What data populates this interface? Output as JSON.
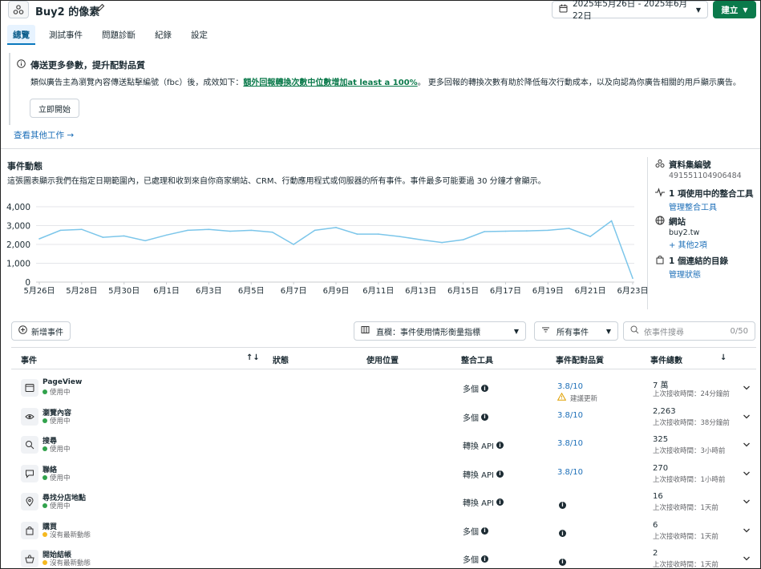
{
  "header": {
    "title": "Buy2 的像素",
    "date_range": "2025年5月26日 - 2025年6月22日",
    "create_label": "建立"
  },
  "tabs": [
    {
      "label": "總覽",
      "active": true
    },
    {
      "label": "測試事件"
    },
    {
      "label": "問題診斷"
    },
    {
      "label": "紀錄"
    },
    {
      "label": "設定"
    }
  ],
  "notice": {
    "title": "傳送更多參數，提升配對品質",
    "body_prefix": "類似廣告主為瀏覽內容傳送點擊編號（fbc）後，成效如下：",
    "body_link": "額外回報轉換次數中位數增加at least a 100%",
    "body_suffix": "。 更多回報的轉換次數有助於降低每次行動成本，以及向認為你廣告相關的用戶顯示廣告。",
    "start_label": "立即開始",
    "other_work": "查看其他工作 →"
  },
  "activity": {
    "title": "事件動態",
    "description": "這張圖表顯示我們在指定日期範圍內，已處理和收到來自你商家網站、CRM、行動應用程式或伺服器的所有事件。事件最多可能要過 30 分鐘才會顯示。"
  },
  "chart_data": {
    "type": "line",
    "x_tick_labels": [
      "5月26日",
      "5月28日",
      "5月30日",
      "6月1日",
      "6月3日",
      "6月5日",
      "6月7日",
      "6月9日",
      "6月11日",
      "6月13日",
      "6月15日",
      "6月17日",
      "6月19日",
      "6月21日",
      "6月23日"
    ],
    "y_tick_labels": [
      "0",
      "1,000",
      "2,000",
      "3,000",
      "4,000"
    ],
    "ylim": [
      0,
      4000
    ],
    "x": [
      "5月26日",
      "5月27日",
      "5月28日",
      "5月29日",
      "5月30日",
      "5月31日",
      "6月1日",
      "6月2日",
      "6月3日",
      "6月4日",
      "6月5日",
      "6月6日",
      "6月7日",
      "6月8日",
      "6月9日",
      "6月10日",
      "6月11日",
      "6月12日",
      "6月13日",
      "6月14日",
      "6月15日",
      "6月16日",
      "6月17日",
      "6月18日",
      "6月19日",
      "6月20日",
      "6月21日",
      "6月22日",
      "6月23日"
    ],
    "values": [
      2300,
      2750,
      2800,
      2380,
      2450,
      2200,
      2500,
      2750,
      2800,
      2700,
      2750,
      2650,
      2000,
      2750,
      2900,
      2550,
      2550,
      2420,
      2250,
      2100,
      2250,
      2680,
      2700,
      2720,
      2750,
      2850,
      2420,
      3250,
      200
    ],
    "color": "#7cc6ea",
    "grid": true
  },
  "sidebar": {
    "dataset_label": "資料集編號",
    "dataset_id": "491551104906484",
    "integrations_label": "1 項使用中的整合工具",
    "integrations_link": "管理整合工具",
    "website_label": "網站",
    "website_value": "buy2.tw",
    "website_link": "+ 其他2項",
    "catalog_label": "1 個連結的目錄",
    "catalog_link": "管理狀態"
  },
  "toolbar": {
    "add_event": "新增事件",
    "columns_select": "直欄：事件使用情形衡量指標",
    "events_select": "所有事件",
    "search_placeholder": "依事件搜尋",
    "search_count": "0/50"
  },
  "table": {
    "headers": {
      "event": "事件",
      "sort": "↑↓",
      "status": "狀態",
      "usage": "使用位置",
      "tool": "整合工具",
      "quality": "事件配對品質",
      "total": "事件總數",
      "total_sort": "↓"
    },
    "rows": [
      {
        "name": "PageView",
        "status": "使用中",
        "status_color": "#31a24c",
        "icon": "browser-icon",
        "tool": "多個",
        "quality": "3.8/10",
        "warning": "建議更新",
        "total": "7 萬",
        "last": "上次接收時間：24分鐘前"
      },
      {
        "name": "瀏覽內容",
        "status": "使用中",
        "status_color": "#31a24c",
        "icon": "eye-icon",
        "tool": "多個",
        "quality": "3.8/10",
        "total": "2,263",
        "last": "上次接收時間：38分鐘前"
      },
      {
        "name": "搜尋",
        "status": "使用中",
        "status_color": "#31a24c",
        "icon": "search-icon",
        "tool": "轉換 API",
        "quality": "3.8/10",
        "total": "325",
        "last": "上次接收時間：3小時前"
      },
      {
        "name": "聯絡",
        "status": "使用中",
        "status_color": "#31a24c",
        "icon": "chat-icon",
        "tool": "轉換 API",
        "quality": "3.8/10",
        "total": "270",
        "last": "上次接收時間：1小時前"
      },
      {
        "name": "尋找分店地點",
        "status": "使用中",
        "status_color": "#31a24c",
        "icon": "location-icon",
        "tool": "轉換 API",
        "quality": "",
        "total": "16",
        "last": "上次接收時間：1天前"
      },
      {
        "name": "購買",
        "status": "沒有最新動態",
        "status_color": "#f5b91f",
        "icon": "bag-icon",
        "tool": "多個",
        "quality": "",
        "total": "6",
        "last": "上次接收時間：1天前"
      },
      {
        "name": "開始結帳",
        "status": "沒有最新動態",
        "status_color": "#f5b91f",
        "icon": "basket-icon",
        "tool": "多個",
        "quality": "",
        "total": "2",
        "last": "上次接收時間：1天前"
      }
    ]
  }
}
